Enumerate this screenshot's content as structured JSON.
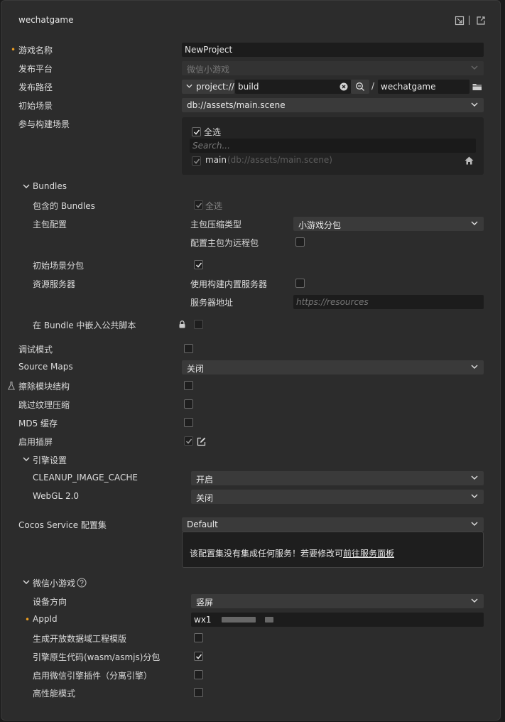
{
  "window": {
    "title": "wechatgame"
  },
  "basic": {
    "game_name_label": "游戏名称",
    "game_name_value": "NewProject",
    "platform_label": "发布平台",
    "platform_value": "微信小游戏",
    "path_label": "发布路径",
    "path_protocol": "project://",
    "path_folder": "build",
    "path_separator": "/",
    "path_target": "wechatgame",
    "start_scene_label": "初始场景",
    "start_scene_value": "db://assets/main.scene",
    "build_scenes_label": "参与构建场景",
    "select_all_label": "全选",
    "search_placeholder": "Search...",
    "scene_name": "main",
    "scene_path": "(db://assets/main.scene)"
  },
  "bundles": {
    "section_label": "Bundles",
    "included_label": "包含的 Bundles",
    "included_select_all": "全选",
    "main_config_label": "主包配置",
    "compress_type_label": "主包压缩类型",
    "compress_type_value": "小游戏分包",
    "remote_main_label": "配置主包为远程包",
    "start_scene_subpack_label": "初始场景分包",
    "resource_server_label": "资源服务器",
    "builtin_server_label": "使用构建内置服务器",
    "server_address_label": "服务器地址",
    "server_address_placeholder": "https://resources",
    "embed_scripts_label": "在 Bundle 中嵌入公共脚本"
  },
  "options": {
    "debug_label": "调试模式",
    "source_maps_label": "Source Maps",
    "source_maps_value": "关闭",
    "erase_modules_label": "擦除模块结构",
    "skip_texture_label": "跳过纹理压缩",
    "md5_label": "MD5 缓存",
    "splash_label": "启用插屏"
  },
  "engine": {
    "section_label": "引擎设置",
    "cleanup_label": "CLEANUP_IMAGE_CACHE",
    "cleanup_value": "开启",
    "webgl_label": "WebGL 2.0",
    "webgl_value": "关闭"
  },
  "service": {
    "label": "Cocos Service 配置集",
    "value": "Default",
    "message": "该配置集没有集成任何服务！若要修改可",
    "link": "前往服务面板"
  },
  "wechat": {
    "section_label": "微信小游戏",
    "orientation_label": "设备方向",
    "orientation_value": "竖屏",
    "appid_label": "AppId",
    "appid_value": "wx1",
    "open_data_label": "生成开放数据域工程模版",
    "native_code_label": "引擎原生代码(wasm/asmjs)分包",
    "plugin_label": "启用微信引擎插件（分离引擎）",
    "high_perf_label": "高性能模式"
  },
  "colors": {
    "panel": "#2c2c2c",
    "input": "#1c1c1c",
    "select": "#3a3a3a",
    "required": "#f0a020"
  },
  "icons": [
    "close-icon",
    "export-icon",
    "open-external-icon",
    "clear-icon",
    "search-icon",
    "folder-icon",
    "home-icon",
    "lock-icon",
    "edit-icon",
    "help-icon",
    "chevron-down-icon",
    "check-icon"
  ]
}
